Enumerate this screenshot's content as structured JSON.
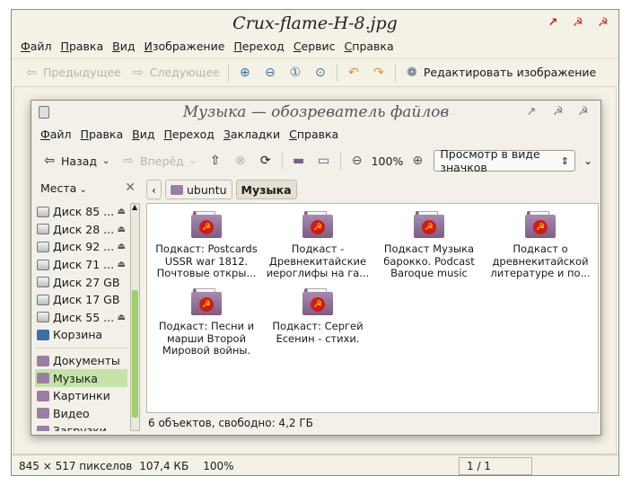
{
  "viewer": {
    "title": "Crux-flame-H-8.jpg",
    "window_buttons": [
      "↗",
      "☭",
      "☭"
    ],
    "menu": [
      "Файл",
      "Правка",
      "Вид",
      "Изображение",
      "Переход",
      "Сервис",
      "Справка"
    ],
    "toolbar": {
      "prev": "Предыдущее",
      "next": "Следующее",
      "edit": "Редактировать изображение"
    },
    "status": {
      "dimensions": "845 × 517 пикселов",
      "size": "107,4 КБ",
      "zoom": "100%",
      "page": "1 / 1"
    }
  },
  "fm": {
    "title": "Музыка — обозреватель файлов",
    "window_buttons": [
      "↗",
      "☭",
      "☭"
    ],
    "menu": [
      "Файл",
      "Правка",
      "Вид",
      "Переход",
      "Закладки",
      "Справка"
    ],
    "toolbar": {
      "back": "Назад",
      "forward": "Вперёд",
      "zoom": "100%",
      "view_mode": "Просмотр в виде значков"
    },
    "sidebar": {
      "header": "Места",
      "items": [
        {
          "label": "Диск 85 ...",
          "type": "drive",
          "eject": true
        },
        {
          "label": "Диск 28 ...",
          "type": "drive",
          "eject": true
        },
        {
          "label": "Диск 92 ...",
          "type": "drive",
          "eject": true
        },
        {
          "label": "Диск 71 ...",
          "type": "drive",
          "eject": true
        },
        {
          "label": "Диск 27 GB",
          "type": "drive",
          "eject": false
        },
        {
          "label": "Диск 17 GB",
          "type": "drive",
          "eject": false
        },
        {
          "label": "Диск 55 ...",
          "type": "drive",
          "eject": true
        },
        {
          "label": "Корзина",
          "type": "trash",
          "eject": false
        },
        {
          "label": "Документы",
          "type": "folder",
          "eject": false
        },
        {
          "label": "Музыка",
          "type": "folder",
          "eject": false,
          "active": true
        },
        {
          "label": "Картинки",
          "type": "folder",
          "eject": false
        },
        {
          "label": "Видео",
          "type": "folder",
          "eject": false
        },
        {
          "label": "Загрузки",
          "type": "folder",
          "eject": false
        }
      ]
    },
    "path": [
      "ubuntu",
      "Музыка"
    ],
    "files": [
      {
        "line1": "Подкаст: Postcards",
        "line2": "USSR war 1812.",
        "line3": "Почтовые откры..."
      },
      {
        "line1": "Подкаст -",
        "line2": "Древнекитайские",
        "line3": "иероглифы на га..."
      },
      {
        "line1": "Подкаст Музыка",
        "line2": "барокко. Podcast",
        "line3": "Baroque music"
      },
      {
        "line1": "Подкаст о",
        "line2": "древнекитайской",
        "line3": "литературе и по..."
      },
      {
        "line1": "Подкаст: Песни и",
        "line2": "марши Второй",
        "line3": "Мировой войны."
      },
      {
        "line1": "Подкаст: Сергей",
        "line2": "Есенин - стихи.",
        "line3": ""
      }
    ],
    "status": "6 объектов, свободно: 4,2 ГБ"
  },
  "colors": {
    "emblem": "#d11b10",
    "folder": "#9b7fa3",
    "active_place": "#c5e3a8",
    "scroll_thumb": "#9fd06e"
  }
}
